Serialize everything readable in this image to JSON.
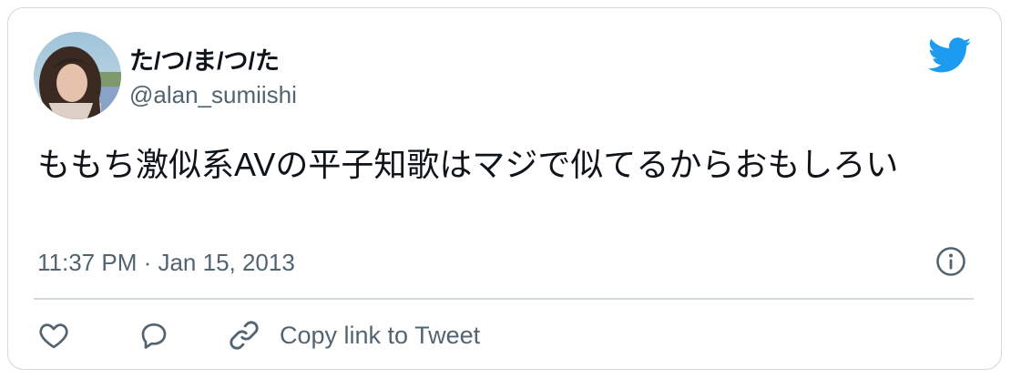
{
  "tweet": {
    "author": {
      "display_name": "た/つ/ま/つ/た",
      "handle": "@alan_sumiishi"
    },
    "text": "ももち激似系AVの平子知歌はマジで似てるからおもしろい",
    "timestamp": "11:37 PM · Jan 15, 2013"
  },
  "actions": {
    "like_icon": "heart-icon",
    "reply_icon": "speech-bubble-icon",
    "copy_link_icon": "link-icon",
    "copy_link_label": "Copy link to Tweet"
  },
  "icons": {
    "brand": "twitter-bird-icon",
    "info": "info-icon"
  },
  "colors": {
    "brand_blue": "#1d9bf0",
    "text_primary": "#0f1419",
    "text_secondary": "#536471",
    "border": "#cfd9de"
  }
}
